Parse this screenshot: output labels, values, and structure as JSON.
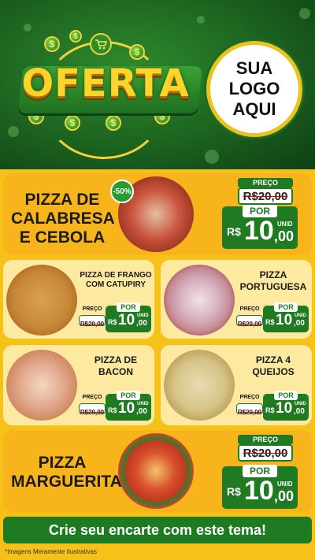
{
  "header": {
    "title": "OFERTA",
    "logo_line1": "SUA",
    "logo_line2": "LOGO",
    "logo_line3": "AQUI",
    "currency_icon": "$",
    "cart_icon": "cart-icon"
  },
  "products": {
    "calabresa": {
      "name_line1": "PIZZA DE",
      "name_line2": "CALABRESA",
      "name_line3": "E CEBOLA",
      "discount": "-50%",
      "preco_label": "PREÇO",
      "old_price": "R$20,00",
      "por_label": "POR",
      "currency": "R$",
      "price_int": "10",
      "price_cents": ",00",
      "unit": "UNID"
    },
    "frango": {
      "name_line1": "PIZZA DE FRANGO",
      "name_line2": "COM CATUPIRY",
      "preco_label": "PREÇO",
      "old_price": "R$20,00",
      "por_label": "POR",
      "currency": "R$",
      "price_int": "10",
      "price_cents": ",00",
      "unit": "UNID"
    },
    "portuguesa": {
      "name_line1": "PIZZA",
      "name_line2": "PORTUGUESA",
      "preco_label": "PREÇO",
      "old_price": "R$20,00",
      "por_label": "POR",
      "currency": "R$",
      "price_int": "10",
      "price_cents": ",00",
      "unit": "UNID"
    },
    "bacon": {
      "name_line1": "PIZZA DE",
      "name_line2": "BACON",
      "preco_label": "PREÇO",
      "old_price": "R$20,00",
      "por_label": "POR",
      "currency": "R$",
      "price_int": "10",
      "price_cents": ",00",
      "unit": "UNID"
    },
    "queijos": {
      "name_line1": "PIZZA 4",
      "name_line2": "QUEIJOS",
      "preco_label": "PREÇO",
      "old_price": "R$20,00",
      "por_label": "POR",
      "currency": "R$",
      "price_int": "10",
      "price_cents": ",00",
      "unit": "UNID"
    },
    "marguerita": {
      "name_line1": "PIZZA",
      "name_line2": "MARGUERITA",
      "preco_label": "PREÇO",
      "old_price": "R$20,00",
      "por_label": "POR",
      "currency": "R$",
      "price_int": "10",
      "price_cents": ",00",
      "unit": "UNID"
    }
  },
  "cta": {
    "label": "Crie seu encarte com este tema!"
  },
  "footnote": "*Imagens Meramente Ilustrativas",
  "colors": {
    "green": "#1f7a22",
    "yellow": "#f6c21a",
    "gold": "#ffd42a"
  }
}
